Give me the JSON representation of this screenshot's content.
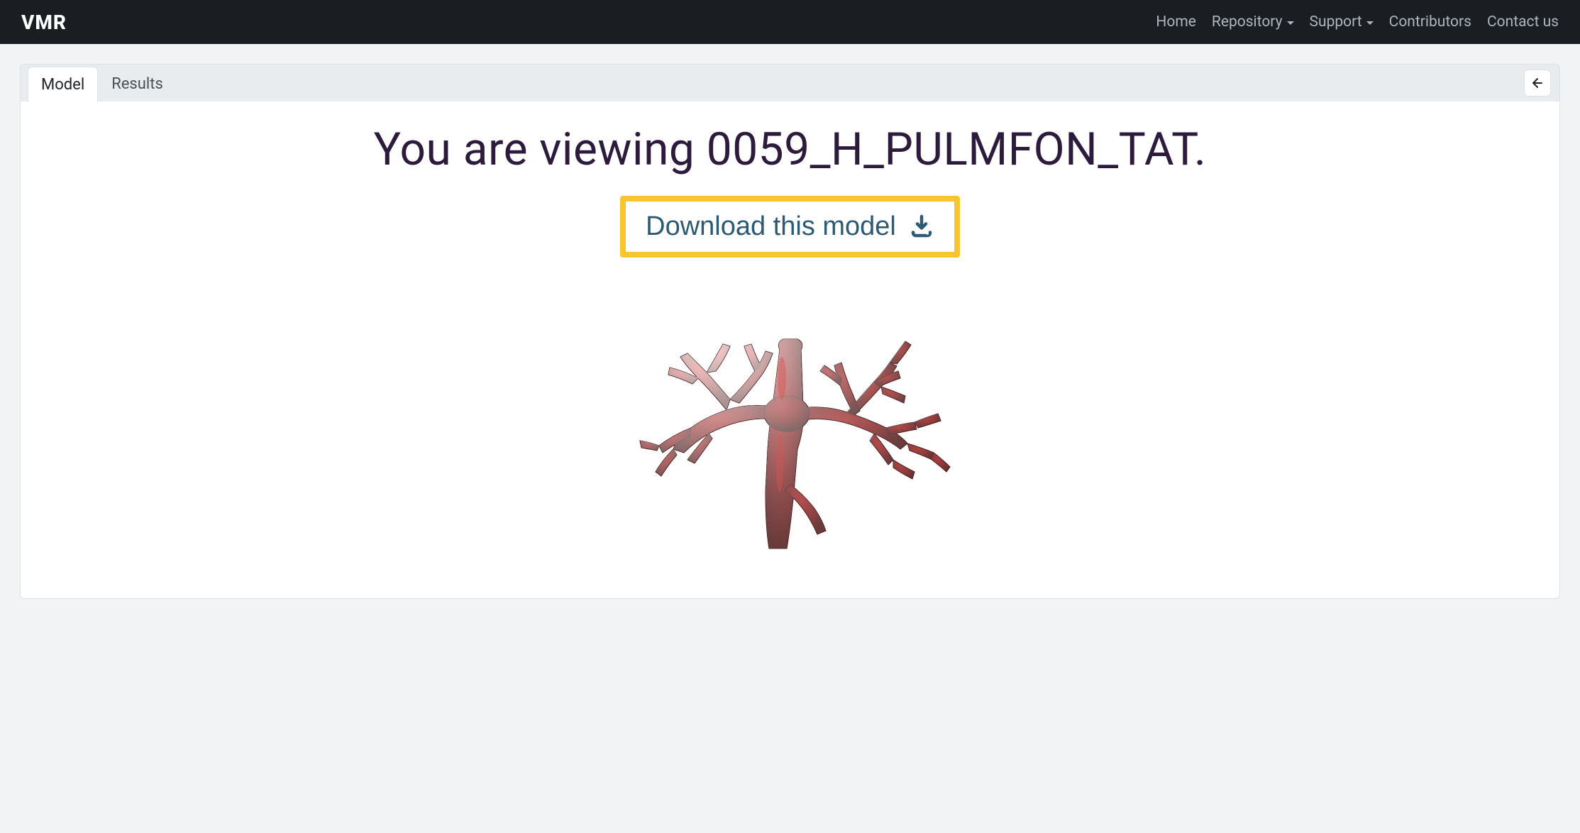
{
  "navbar": {
    "brand": "VMR",
    "links": {
      "home": "Home",
      "repository": "Repository",
      "support": "Support",
      "contributors": "Contributors",
      "contact": "Contact us"
    }
  },
  "tabs": {
    "model": "Model",
    "results": "Results"
  },
  "page": {
    "title_prefix": "You are viewing ",
    "model_id": "0059_H_PULMFON_TAT",
    "title_suffix": "."
  },
  "download": {
    "label": "Download this model"
  }
}
